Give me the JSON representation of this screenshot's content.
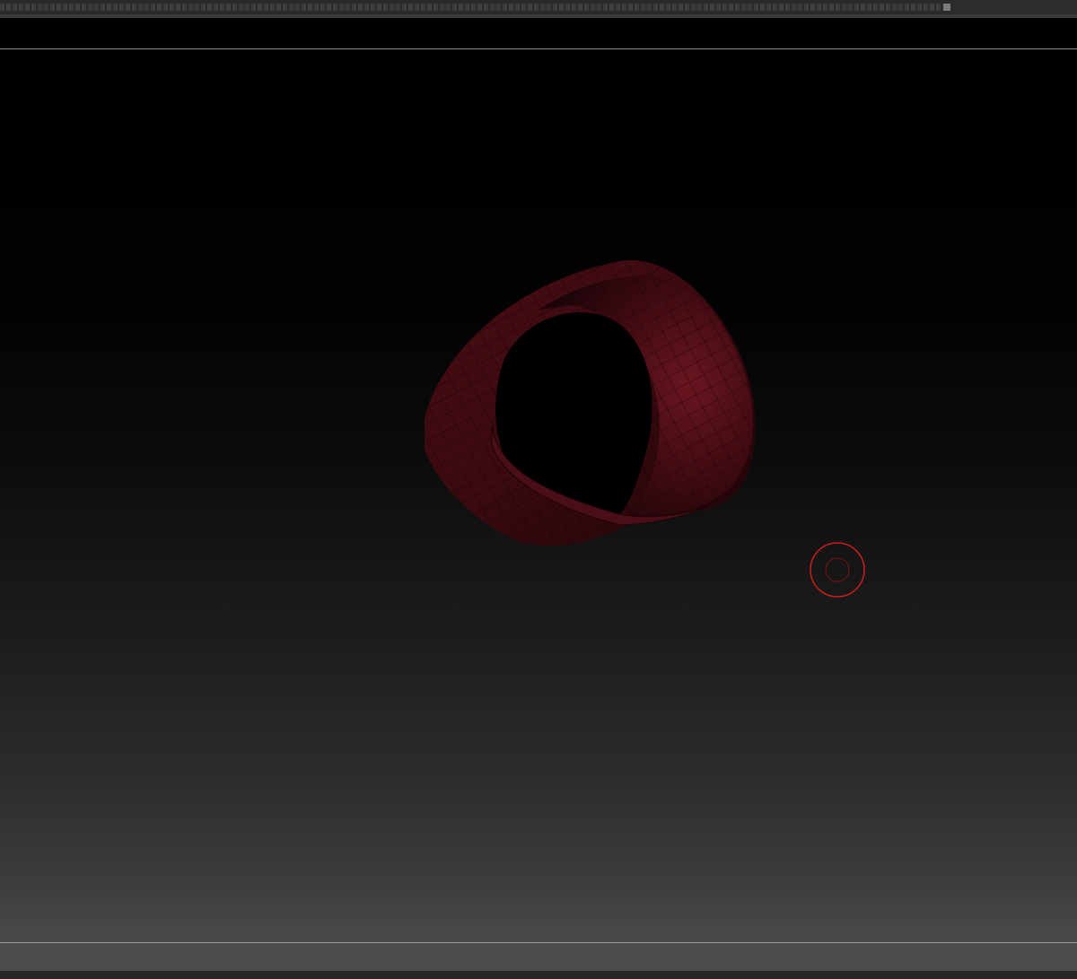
{
  "app": {
    "view": "3d-viewport"
  },
  "viewport": {
    "object": "hollow-tube-mesh",
    "mesh_color": "#5a0f18",
    "cursor": "brush-cursor",
    "cursor_color": "#c81e1e"
  },
  "colors": {
    "background_top": "#000000",
    "background_bottom": "#4a4a4a",
    "ui_bar": "#2a2a2a"
  }
}
